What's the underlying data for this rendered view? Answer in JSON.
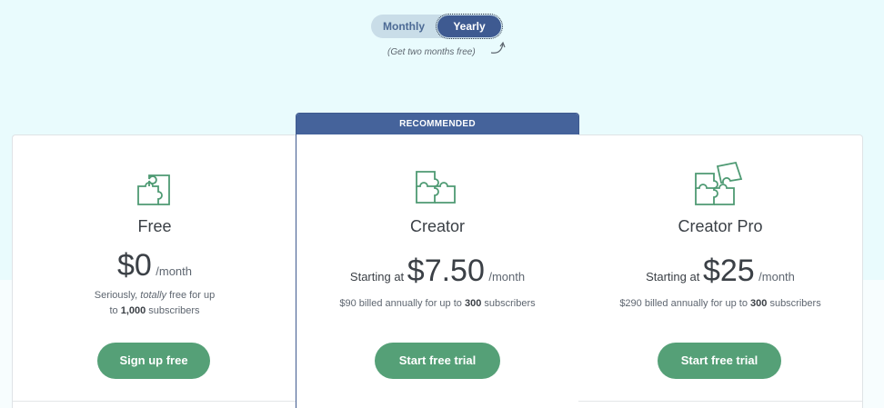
{
  "billing_toggle": {
    "monthly_label": "Monthly",
    "yearly_label": "Yearly",
    "selected": "Yearly",
    "promo": "(Get two months free)"
  },
  "plans": [
    {
      "name": "Free",
      "price_prefix": "",
      "price": "$0",
      "period": "/month",
      "desc_1": "Seriously, ",
      "desc_em": "totally",
      "desc_2": " free for up",
      "desc_3": "to ",
      "desc_bold": "1,000",
      "desc_4": " subscribers",
      "cta": "Sign up free",
      "icon": "puzzle-piece-icon"
    },
    {
      "badge": "RECOMMENDED",
      "name": "Creator",
      "price_prefix": "Starting at ",
      "price": "$7.50",
      "period": "/month",
      "desc_1": "$90 billed annually for up to ",
      "desc_bold": "300",
      "desc_2": " subscribers",
      "cta": "Start free trial",
      "icon": "puzzle-pieces-icon"
    },
    {
      "name": "Creator Pro",
      "price_prefix": "Starting at ",
      "price": "$25",
      "period": "/month",
      "desc_1": "$290 billed annually for up to ",
      "desc_bold": "300",
      "desc_2": " subscribers",
      "cta": "Start free trial",
      "icon": "puzzle-complete-icon"
    }
  ],
  "colors": {
    "accent_green": "#55a077",
    "toggle_active": "#3e5a91",
    "recommended_banner": "#45639b",
    "icon_green": "#4e9a73"
  }
}
